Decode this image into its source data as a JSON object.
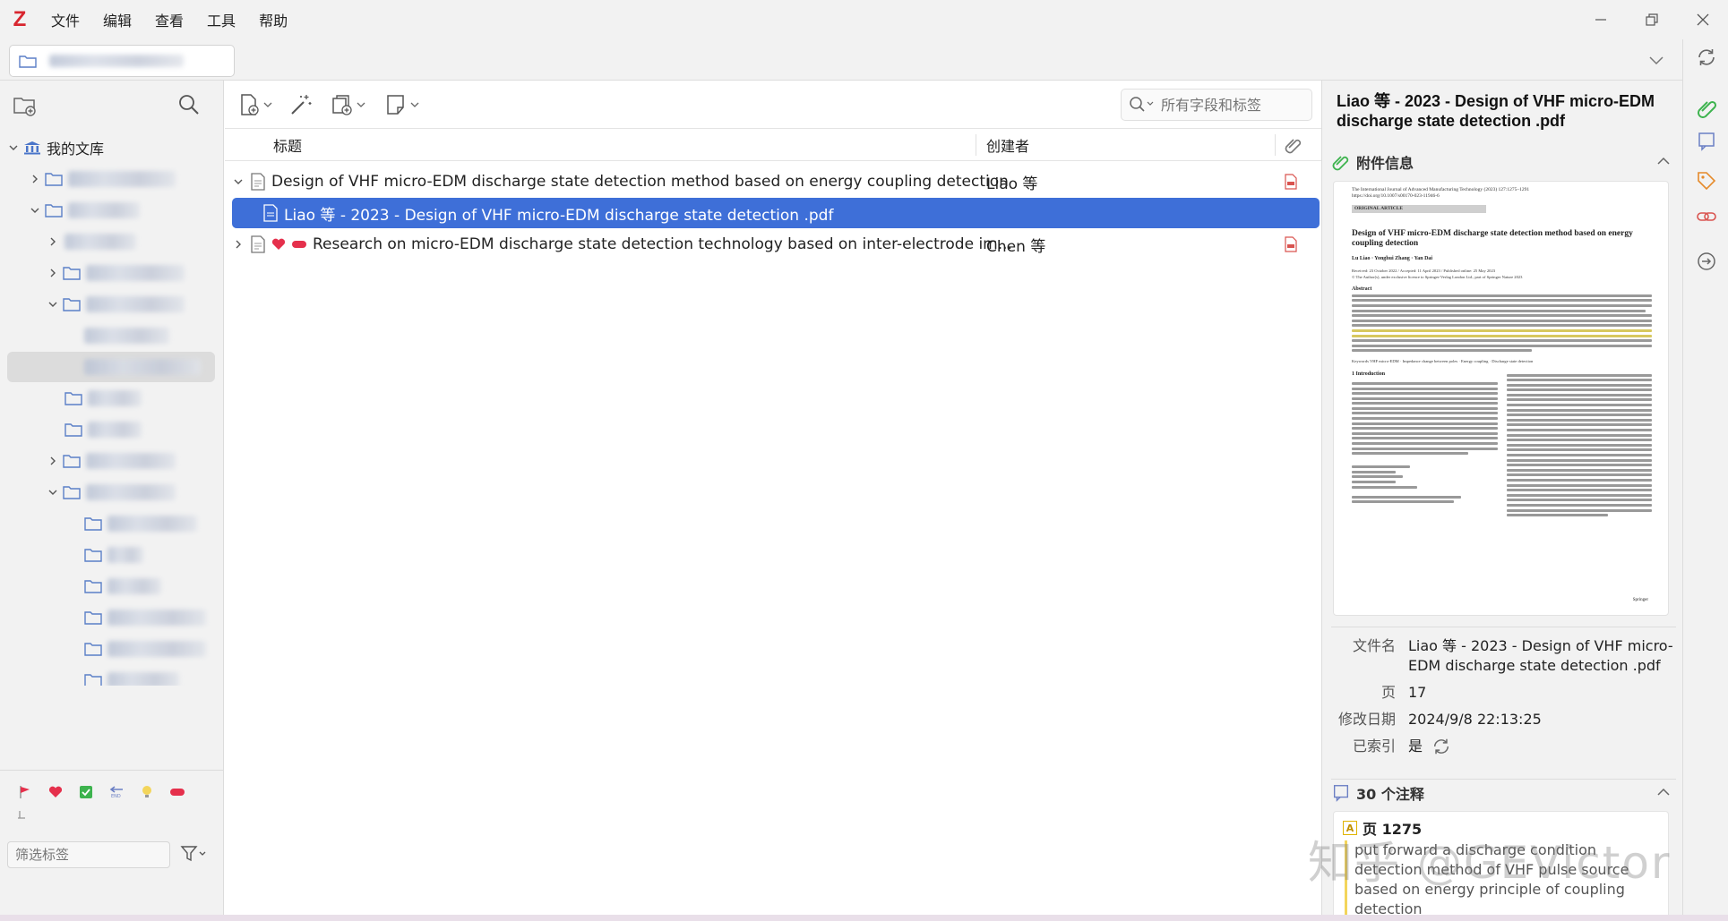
{
  "app": {
    "logo": "Z"
  },
  "menu": {
    "items": [
      "文件",
      "编辑",
      "查看",
      "工具",
      "帮助"
    ]
  },
  "colors": {
    "accent": "#3e6fd8",
    "logo": "#d8262f",
    "highlight": "#f3d55b",
    "tag_red": "#e5304c",
    "tag_green": "#3db34e"
  },
  "left": {
    "library_label": "我的文库",
    "tag_filter_placeholder": "筛选标签"
  },
  "toolbar": {
    "search_placeholder": "所有字段和标签"
  },
  "columns": {
    "title": "标题",
    "creator": "创建者"
  },
  "items": [
    {
      "title": "Design of VHF micro-EDM discharge state detection method based on energy coupling detection",
      "creator": "Liao 等"
    },
    {
      "title": "Liao 等 - 2023 - Design of VHF micro-EDM discharge state detection .pdf",
      "creator": ""
    },
    {
      "title": "Research on micro-EDM discharge state detection technology based on inter-electrode im...",
      "creator": "Chen 等"
    }
  ],
  "right": {
    "title": "Liao 等 - 2023 - Design of VHF micro-EDM discharge state detection .pdf",
    "attachment_section": "附件信息",
    "preview": {
      "journal": "The International Journal of Advanced Manufacturing Technology (2023) 127:1275–1291",
      "doi": "https://doi.org/10.1007/s00170-023-11946-6",
      "badge": "ORIGINAL ARTICLE",
      "title": "Design of VHF micro-EDM discharge state detection method based on energy coupling detection",
      "authors": "Lu Liao · Yonghui Zhang · Yan Dai",
      "received": "Received: 23 October 2022 / Accepted: 11 April 2023 / Published online: 25 May 2023",
      "license": "© The Author(s), under exclusive licence to Springer-Verlag London Ltd., part of Springer Nature 2023",
      "abstract_head": "Abstract",
      "keywords": "Keywords  VHF micro-EDM · Impedance change between poles · Energy coupling · Discharge state detection",
      "intro_head": "1  Introduction",
      "publisher": "Springer"
    },
    "meta": [
      {
        "key": "文件名",
        "value": "Liao 等 - 2023 - Design of VHF micro-EDM discharge state detection .pdf"
      },
      {
        "key": "页",
        "value": "17"
      },
      {
        "key": "修改日期",
        "value": "2024/9/8 22:13:25"
      },
      {
        "key": "已索引",
        "value": "是"
      }
    ],
    "notes_section": "30 个注释",
    "note": {
      "page": "页 1275",
      "text": "put forward a discharge condition detection method of VHF pulse source based on energy principle of coupling detection"
    }
  },
  "watermark": "知乎 @GEVictor"
}
